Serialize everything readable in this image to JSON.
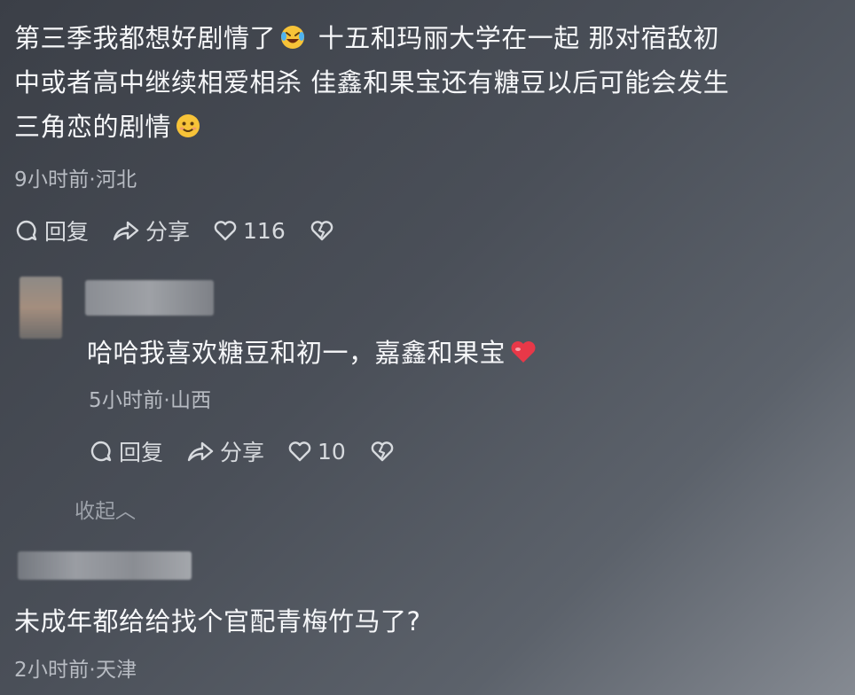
{
  "comment1": {
    "line1": "第三季我都想好剧情了",
    "line1b": "十五和玛丽大学在一起 那对宿敌初",
    "line2": "中或者高中继续相爱相杀 佳鑫和果宝还有糖豆以后可能会发生",
    "line3": "三角恋的剧情",
    "meta": "9小时前·河北",
    "reply_label": "回复",
    "share_label": "分享",
    "like_count": "116",
    "emoji_1": "laughing-crying-emoji",
    "emoji_2": "smiling-emoji"
  },
  "reply1": {
    "text": "哈哈我喜欢糖豆和初一，嘉鑫和果宝",
    "meta": "5小时前·山西",
    "reply_label": "回复",
    "share_label": "分享",
    "like_count": "10",
    "emoji": "red-heart-emoji"
  },
  "collapse_label": "收起︿",
  "comment2": {
    "text": "未成年都给给找个官配青梅竹马了?",
    "meta": "2小时前·天津"
  },
  "colors": {
    "text": "#f6f7f9",
    "meta": "#b8bcc3",
    "action": "#d7dade",
    "collapse": "#9da2aa"
  }
}
